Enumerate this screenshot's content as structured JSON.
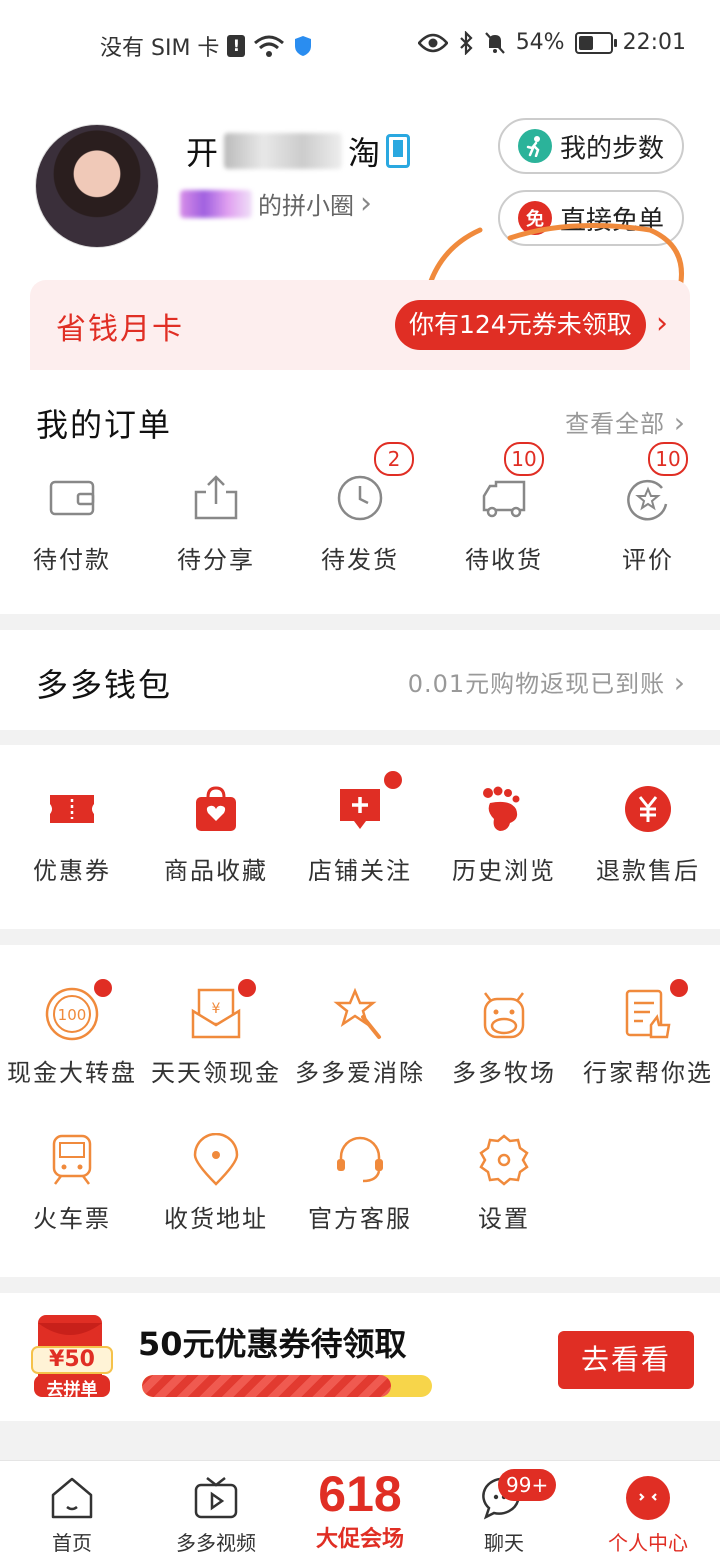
{
  "status_bar": {
    "carrier": "没有 SIM 卡",
    "sim_icon_text": "!",
    "battery": "54%",
    "battery_level": 0.54,
    "time": "22:01"
  },
  "profile": {
    "name_visible_start": "开",
    "name_visible_end": "淘",
    "circle_text": "的拼小圈",
    "circle_arrow": "›"
  },
  "quick_buttons": [
    {
      "label": "我的步数",
      "icon": "walk-icon",
      "color": "#2bb39a"
    },
    {
      "label": "直接免单",
      "icon": "free-icon",
      "icon_text": "免",
      "color": "#e02e24"
    }
  ],
  "month_card": {
    "title": "省钱月卡",
    "badge": "你有124元券未领取",
    "arrow": "›"
  },
  "orders": {
    "title": "我的订单",
    "view_all": "查看全部",
    "items": [
      {
        "label": "待付款",
        "icon": "wallet-icon",
        "badge": ""
      },
      {
        "label": "待分享",
        "icon": "share-icon",
        "badge": ""
      },
      {
        "label": "待发货",
        "icon": "clock-icon",
        "badge": "2"
      },
      {
        "label": "待收货",
        "icon": "truck-icon",
        "badge": "10"
      },
      {
        "label": "评价",
        "icon": "review-icon",
        "badge": "10"
      }
    ]
  },
  "wallet": {
    "title": "多多钱包",
    "info": "0.01元购物返现已到账"
  },
  "shortcuts": [
    {
      "label": "优惠券",
      "icon": "coupon-icon"
    },
    {
      "label": "商品收藏",
      "icon": "bag-heart-icon"
    },
    {
      "label": "店铺关注",
      "icon": "shop-add-icon",
      "dot": true
    },
    {
      "label": "历史浏览",
      "icon": "footprint-icon"
    },
    {
      "label": "退款售后",
      "icon": "refund-icon"
    }
  ],
  "services": [
    {
      "label": "现金大转盘",
      "icon": "wheel-icon",
      "icon_text": "100",
      "dot": true
    },
    {
      "label": "天天领现金",
      "icon": "envelope-cash-icon",
      "icon_text": "¥",
      "dot": true
    },
    {
      "label": "多多爱消除",
      "icon": "star-wand-icon"
    },
    {
      "label": "多多牧场",
      "icon": "cow-icon"
    },
    {
      "label": "行家帮你选",
      "icon": "checklist-icon",
      "dot": true
    },
    {
      "label": "火车票",
      "icon": "train-icon"
    },
    {
      "label": "收货地址",
      "icon": "location-icon"
    },
    {
      "label": "官方客服",
      "icon": "headset-icon"
    },
    {
      "label": "设置",
      "icon": "settings-icon"
    }
  ],
  "promo": {
    "title": "50元优惠券待领取",
    "coupon_value": "¥50",
    "coupon_caption": "去拼单",
    "button": "去看看",
    "progress": 0.86
  },
  "tabbar": [
    {
      "label": "首页",
      "icon": "home-icon"
    },
    {
      "label": "多多视频",
      "icon": "video-icon"
    },
    {
      "label": "大促会场",
      "big": "618"
    },
    {
      "label": "聊天",
      "icon": "chat-icon",
      "badge": "99+"
    },
    {
      "label": "个人中心",
      "icon": "profile-icon",
      "active": true
    }
  ],
  "colors": {
    "brand": "#e02e24",
    "accent_orange": "#f08a3c",
    "teal": "#2bb39a",
    "blue": "#2aa8e0"
  }
}
